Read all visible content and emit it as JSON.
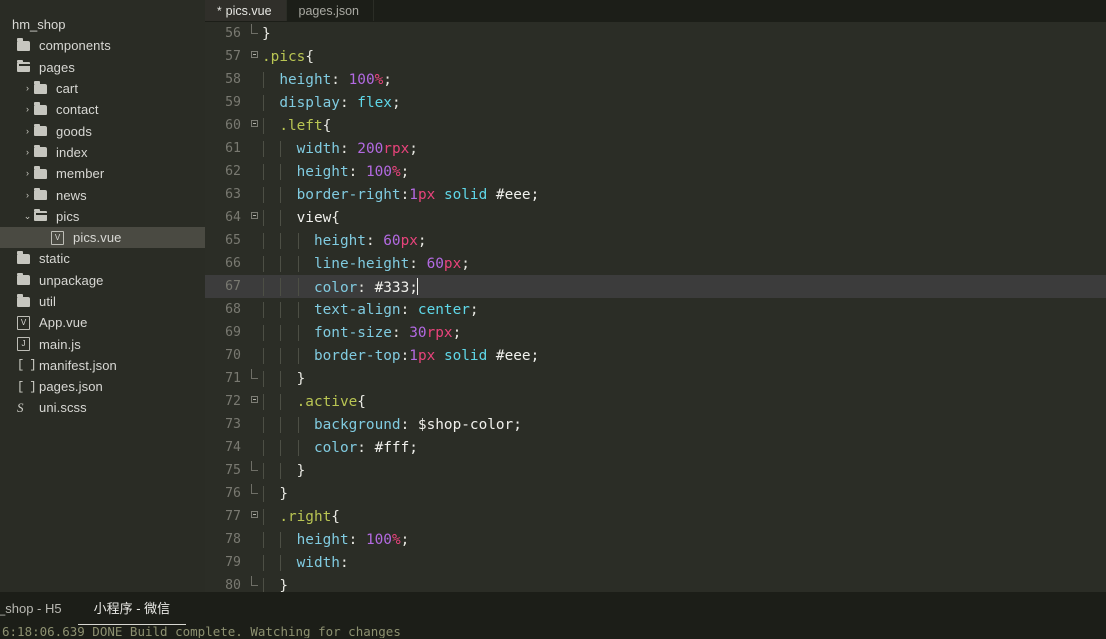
{
  "window": {
    "theme_bg": "#2b2d26",
    "sidebar_bg": "#2a2c25",
    "tabbar_bg": "#1c1e18",
    "selection_bg": "#4a4a42",
    "active_line_bg": "#3c3c3c"
  },
  "sidebar": {
    "root_label": "hm_shop",
    "items": [
      {
        "label": "components",
        "icon": "folder-closed-icon",
        "twisty": "",
        "depth": 0,
        "selected": false
      },
      {
        "label": "pages",
        "icon": "folder-open-icon",
        "twisty": "",
        "depth": 0,
        "selected": false
      },
      {
        "label": "cart",
        "icon": "folder-closed-icon",
        "twisty": "›",
        "depth": 1,
        "selected": false
      },
      {
        "label": "contact",
        "icon": "folder-closed-icon",
        "twisty": "›",
        "depth": 1,
        "selected": false
      },
      {
        "label": "goods",
        "icon": "folder-closed-icon",
        "twisty": "›",
        "depth": 1,
        "selected": false
      },
      {
        "label": "index",
        "icon": "folder-closed-icon",
        "twisty": "›",
        "depth": 1,
        "selected": false
      },
      {
        "label": "member",
        "icon": "folder-closed-icon",
        "twisty": "›",
        "depth": 1,
        "selected": false
      },
      {
        "label": "news",
        "icon": "folder-closed-icon",
        "twisty": "›",
        "depth": 1,
        "selected": false
      },
      {
        "label": "pics",
        "icon": "folder-open-icon",
        "twisty": "⌄",
        "depth": 1,
        "selected": false
      },
      {
        "label": "pics.vue",
        "icon": "vue-file-icon",
        "twisty": "",
        "depth": 2,
        "selected": true
      },
      {
        "label": "static",
        "icon": "folder-closed-icon",
        "twisty": "",
        "depth": 0,
        "selected": false
      },
      {
        "label": "unpackage",
        "icon": "folder-closed-icon",
        "twisty": "",
        "depth": 0,
        "selected": false
      },
      {
        "label": "util",
        "icon": "folder-closed-icon",
        "twisty": "",
        "depth": 0,
        "selected": false
      },
      {
        "label": "App.vue",
        "icon": "vue-file-icon",
        "twisty": "",
        "depth": 0,
        "selected": false
      },
      {
        "label": "main.js",
        "icon": "js-file-icon",
        "twisty": "",
        "depth": 0,
        "selected": false
      },
      {
        "label": "manifest.json",
        "icon": "json-file-icon",
        "twisty": "",
        "depth": 0,
        "selected": false
      },
      {
        "label": "pages.json",
        "icon": "json-file-icon",
        "twisty": "",
        "depth": 0,
        "selected": false
      },
      {
        "label": "uni.scss",
        "icon": "scss-file-icon",
        "twisty": "",
        "depth": 0,
        "selected": false
      }
    ]
  },
  "editor": {
    "tabs": [
      {
        "label": "pics.vue",
        "modified_marker": "*",
        "active": true
      },
      {
        "label": "pages.json",
        "modified_marker": "",
        "active": false
      }
    ],
    "active_line": 67,
    "first_line": 56,
    "lines": [
      {
        "n": "56",
        "fold": "brk-bottom",
        "indent": 0,
        "tokens": [
          {
            "t": "}",
            "c": "t-plain"
          }
        ]
      },
      {
        "n": "57",
        "fold": "box",
        "indent": 0,
        "tokens": [
          {
            "t": ".pics",
            "c": "t-sel"
          },
          {
            "t": "{",
            "c": "t-plain"
          }
        ]
      },
      {
        "n": "58",
        "fold": "",
        "indent": 1,
        "tokens": [
          {
            "t": "height",
            "c": "t-prop"
          },
          {
            "t": ": ",
            "c": "t-plain"
          },
          {
            "t": "100",
            "c": "t-num"
          },
          {
            "t": "%",
            "c": "t-unit"
          },
          {
            "t": ";",
            "c": "t-plain"
          }
        ]
      },
      {
        "n": "59",
        "fold": "",
        "indent": 1,
        "tokens": [
          {
            "t": "display",
            "c": "t-prop"
          },
          {
            "t": ": ",
            "c": "t-plain"
          },
          {
            "t": "flex",
            "c": "t-val"
          },
          {
            "t": ";",
            "c": "t-plain"
          }
        ]
      },
      {
        "n": "60",
        "fold": "box",
        "indent": 1,
        "tokens": [
          {
            "t": ".left",
            "c": "t-sel"
          },
          {
            "t": "{",
            "c": "t-plain"
          }
        ]
      },
      {
        "n": "61",
        "fold": "",
        "indent": 2,
        "tokens": [
          {
            "t": "width",
            "c": "t-prop"
          },
          {
            "t": ": ",
            "c": "t-plain"
          },
          {
            "t": "200",
            "c": "t-num"
          },
          {
            "t": "rpx",
            "c": "t-unit"
          },
          {
            "t": ";",
            "c": "t-plain"
          }
        ]
      },
      {
        "n": "62",
        "fold": "",
        "indent": 2,
        "tokens": [
          {
            "t": "height",
            "c": "t-prop"
          },
          {
            "t": ": ",
            "c": "t-plain"
          },
          {
            "t": "100",
            "c": "t-num"
          },
          {
            "t": "%",
            "c": "t-unit"
          },
          {
            "t": ";",
            "c": "t-plain"
          }
        ]
      },
      {
        "n": "63",
        "fold": "",
        "indent": 2,
        "tokens": [
          {
            "t": "border-right",
            "c": "t-prop"
          },
          {
            "t": ":",
            "c": "t-plain"
          },
          {
            "t": "1",
            "c": "t-num"
          },
          {
            "t": "px",
            "c": "t-unit"
          },
          {
            "t": " ",
            "c": "t-plain"
          },
          {
            "t": "solid",
            "c": "t-val"
          },
          {
            "t": " #eee;",
            "c": "t-white"
          }
        ]
      },
      {
        "n": "64",
        "fold": "box",
        "indent": 2,
        "tokens": [
          {
            "t": "view",
            "c": "t-white"
          },
          {
            "t": "{",
            "c": "t-plain"
          }
        ]
      },
      {
        "n": "65",
        "fold": "",
        "indent": 3,
        "tokens": [
          {
            "t": "height",
            "c": "t-prop"
          },
          {
            "t": ": ",
            "c": "t-plain"
          },
          {
            "t": "60",
            "c": "t-num"
          },
          {
            "t": "px",
            "c": "t-unit"
          },
          {
            "t": ";",
            "c": "t-plain"
          }
        ]
      },
      {
        "n": "66",
        "fold": "",
        "indent": 3,
        "tokens": [
          {
            "t": "line-height",
            "c": "t-prop"
          },
          {
            "t": ": ",
            "c": "t-plain"
          },
          {
            "t": "60",
            "c": "t-num"
          },
          {
            "t": "px",
            "c": "t-unit"
          },
          {
            "t": ";",
            "c": "t-plain"
          }
        ]
      },
      {
        "n": "67",
        "fold": "",
        "indent": 3,
        "active": true,
        "cursor": true,
        "tokens": [
          {
            "t": "color",
            "c": "t-prop"
          },
          {
            "t": ": ",
            "c": "t-plain"
          },
          {
            "t": "#333;",
            "c": "t-white"
          }
        ]
      },
      {
        "n": "68",
        "fold": "",
        "indent": 3,
        "tokens": [
          {
            "t": "text-align",
            "c": "t-prop"
          },
          {
            "t": ": ",
            "c": "t-plain"
          },
          {
            "t": "center",
            "c": "t-val"
          },
          {
            "t": ";",
            "c": "t-plain"
          }
        ]
      },
      {
        "n": "69",
        "fold": "",
        "indent": 3,
        "tokens": [
          {
            "t": "font-size",
            "c": "t-prop"
          },
          {
            "t": ": ",
            "c": "t-plain"
          },
          {
            "t": "30",
            "c": "t-num"
          },
          {
            "t": "rpx",
            "c": "t-unit"
          },
          {
            "t": ";",
            "c": "t-plain"
          }
        ]
      },
      {
        "n": "70",
        "fold": "",
        "indent": 3,
        "tokens": [
          {
            "t": "border-top",
            "c": "t-prop"
          },
          {
            "t": ":",
            "c": "t-plain"
          },
          {
            "t": "1",
            "c": "t-num"
          },
          {
            "t": "px",
            "c": "t-unit"
          },
          {
            "t": " ",
            "c": "t-plain"
          },
          {
            "t": "solid",
            "c": "t-val"
          },
          {
            "t": " #eee;",
            "c": "t-white"
          }
        ]
      },
      {
        "n": "71",
        "fold": "brk-bottom",
        "indent": 2,
        "tokens": [
          {
            "t": "}",
            "c": "t-plain"
          }
        ]
      },
      {
        "n": "72",
        "fold": "box",
        "indent": 2,
        "tokens": [
          {
            "t": ".active",
            "c": "t-sel"
          },
          {
            "t": "{",
            "c": "t-plain"
          }
        ]
      },
      {
        "n": "73",
        "fold": "",
        "indent": 3,
        "tokens": [
          {
            "t": "background",
            "c": "t-prop"
          },
          {
            "t": ": ",
            "c": "t-plain"
          },
          {
            "t": "$shop-color;",
            "c": "t-white"
          }
        ]
      },
      {
        "n": "74",
        "fold": "",
        "indent": 3,
        "tokens": [
          {
            "t": "color",
            "c": "t-prop"
          },
          {
            "t": ": ",
            "c": "t-plain"
          },
          {
            "t": "#fff;",
            "c": "t-white"
          }
        ]
      },
      {
        "n": "75",
        "fold": "brk-bottom",
        "indent": 2,
        "tokens": [
          {
            "t": "}",
            "c": "t-plain"
          }
        ]
      },
      {
        "n": "76",
        "fold": "brk-bottom",
        "indent": 1,
        "tokens": [
          {
            "t": "}",
            "c": "t-plain"
          }
        ]
      },
      {
        "n": "77",
        "fold": "box",
        "indent": 1,
        "tokens": [
          {
            "t": ".right",
            "c": "t-sel"
          },
          {
            "t": "{",
            "c": "t-plain"
          }
        ]
      },
      {
        "n": "78",
        "fold": "",
        "indent": 2,
        "tokens": [
          {
            "t": "height",
            "c": "t-prop"
          },
          {
            "t": ": ",
            "c": "t-plain"
          },
          {
            "t": "100",
            "c": "t-num"
          },
          {
            "t": "%",
            "c": "t-unit"
          },
          {
            "t": ";",
            "c": "t-plain"
          }
        ]
      },
      {
        "n": "79",
        "fold": "",
        "indent": 2,
        "tokens": [
          {
            "t": "width",
            "c": "t-prop"
          },
          {
            "t": ":",
            "c": "t-plain"
          }
        ]
      },
      {
        "n": "80",
        "fold": "brk-bottom",
        "indent": 1,
        "tokens": [
          {
            "t": "}",
            "c": "t-plain"
          }
        ]
      }
    ]
  },
  "bottom": {
    "tabs": [
      {
        "label": "_shop - H5",
        "active": false
      },
      {
        "label": "小程序 - 微信",
        "active": true
      }
    ],
    "console_text": "6:18:06.639  DONE  Build complete. Watching for changes"
  }
}
